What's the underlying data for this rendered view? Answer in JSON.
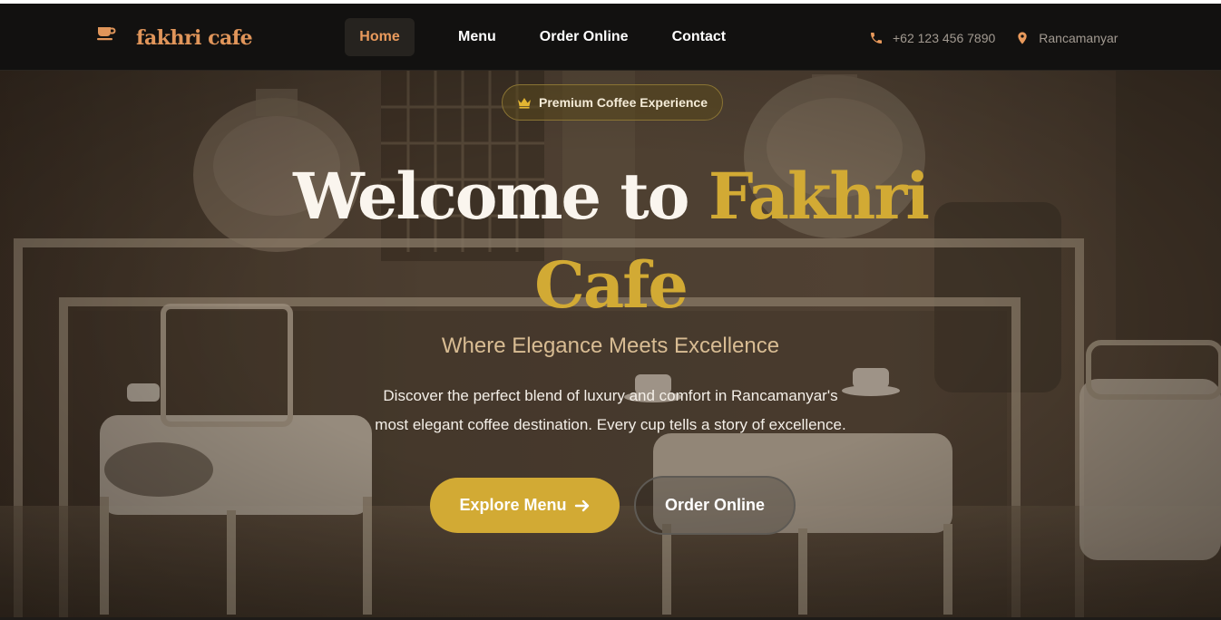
{
  "brand": {
    "name": "fakhri cafe",
    "icon": "coffee-cup-icon"
  },
  "nav": {
    "items": [
      {
        "label": "Home",
        "active": true
      },
      {
        "label": "Menu",
        "active": false
      },
      {
        "label": "Order Online",
        "active": false
      },
      {
        "label": "Contact",
        "active": false
      }
    ]
  },
  "contact": {
    "phone": "+62 123 456 7890",
    "phone_icon": "phone-icon",
    "location": "Rancamanyar",
    "location_icon": "map-pin-icon"
  },
  "hero": {
    "badge": "Premium Coffee Experience",
    "badge_icon": "crown-icon",
    "title_part1": "Welcome to",
    "title_highlight1": "Fakhri",
    "title_highlight2": "Cafe",
    "subtitle": "Where Elegance Meets Excellence",
    "description_line1": "Discover the perfect blend of luxury and comfort in Rancamanyar's",
    "description_line2": "most elegant coffee destination. Every cup tells a story of excellence.",
    "primary_button": "Explore Menu",
    "primary_button_icon": "arrow-right-icon",
    "secondary_button": "Order Online"
  },
  "colors": {
    "navbar_bg": "#121110",
    "brand": "#e0955a",
    "active_nav": "#e99a5c",
    "gold": "#d2aa34",
    "subtitle": "#d8bc93",
    "muted": "#a29a91"
  }
}
